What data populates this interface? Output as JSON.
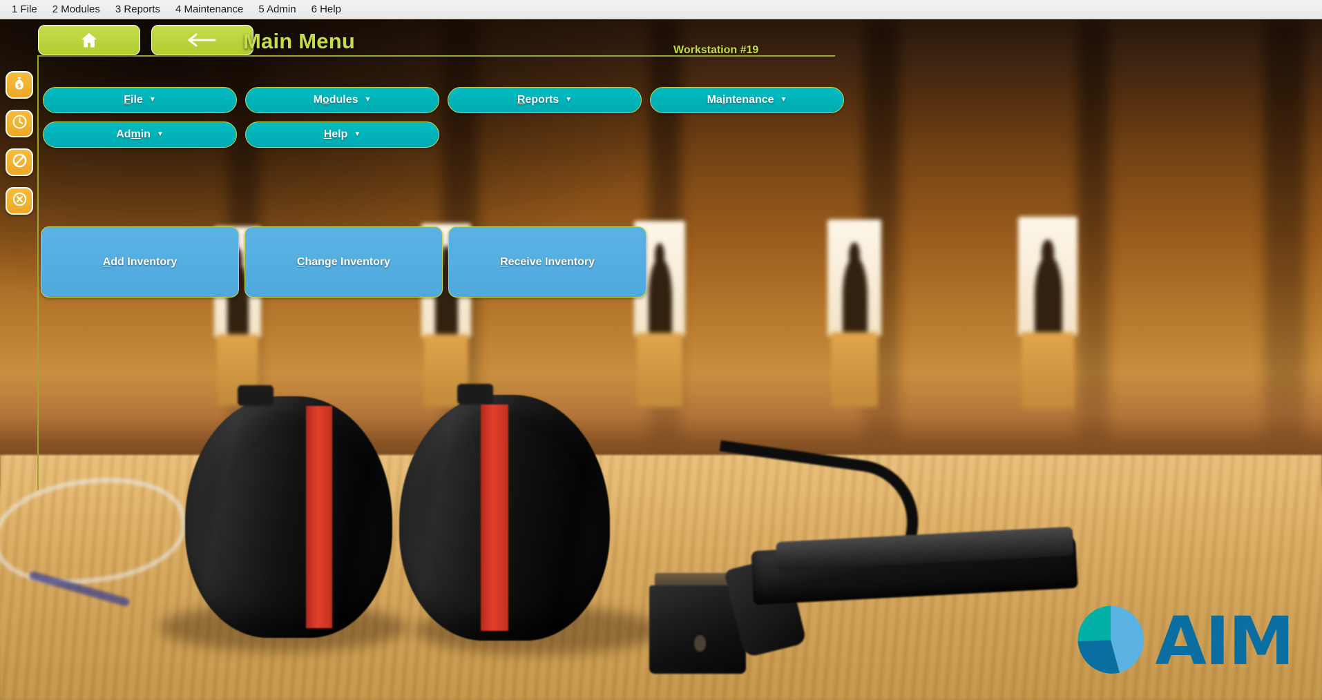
{
  "os_menubar": {
    "items": [
      {
        "label": "1 File"
      },
      {
        "label": "2 Modules"
      },
      {
        "label": "3 Reports"
      },
      {
        "label": "4 Maintenance"
      },
      {
        "label": "5 Admin"
      },
      {
        "label": "6 Help"
      }
    ]
  },
  "header": {
    "title": "Main Menu",
    "workstation": "Workstation #19",
    "home_button": {
      "icon": "home-icon"
    },
    "back_button": {
      "icon": "arrow-left-icon"
    }
  },
  "left_rail": {
    "items": [
      {
        "icon": "money-bag-icon"
      },
      {
        "icon": "clock-icon"
      },
      {
        "icon": "no-entry-icon"
      },
      {
        "icon": "circled-x-icon"
      }
    ]
  },
  "menu_buttons": [
    {
      "label": "File",
      "accel_index": 0,
      "caret": "▼"
    },
    {
      "label": "Modules",
      "accel_index": 1,
      "caret": "▼"
    },
    {
      "label": "Reports",
      "accel_index": 0,
      "caret": "▼"
    },
    {
      "label": "Maintenance",
      "accel_index": 2,
      "caret": "▼"
    },
    {
      "label": "Admin",
      "accel_index": 2,
      "caret": "▼"
    },
    {
      "label": "Help",
      "accel_index": 0,
      "caret": "▼"
    }
  ],
  "inventory_tiles": [
    {
      "label": "Add Inventory",
      "accel_index": 0
    },
    {
      "label": "Change Inventory",
      "accel_index": 0
    },
    {
      "label": "Receive Inventory",
      "accel_index": 0
    }
  ],
  "logo": {
    "wordmark": "AIM",
    "mark_colors": {
      "teal": "#00b0a6",
      "dark_blue": "#0b6ea0",
      "light_blue": "#5bb3e4"
    }
  },
  "colors": {
    "teal_button": "#00b5bb",
    "light_blue_tile": "#56b0e0",
    "green_accent": "#bcd63c",
    "orange_rail": "#f2b133",
    "olive_border": "#9aa82b",
    "brand_blue": "#0b6ea0"
  }
}
